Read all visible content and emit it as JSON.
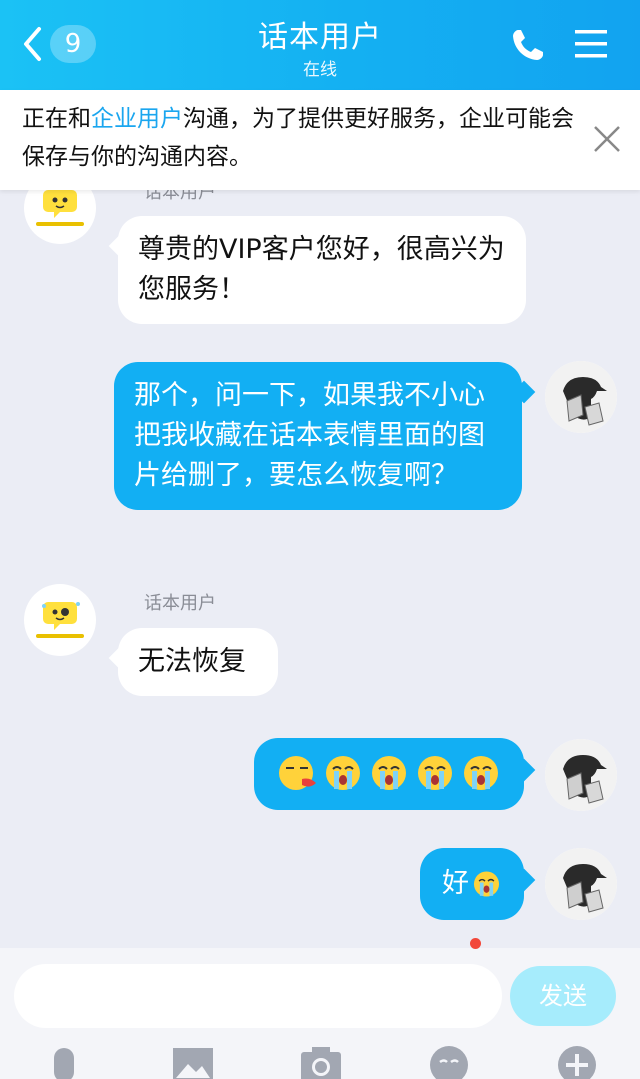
{
  "header": {
    "back_count": "9",
    "title": "话本用户",
    "status": "在线",
    "icons": [
      "chevron-left-icon",
      "phone-icon",
      "menu-icon"
    ]
  },
  "notice": {
    "text_before": "正在和",
    "highlight": "企业用户",
    "text_after": "沟通，为了提供更好服务，企业可能会保存与你的沟通内容。",
    "close_icon": "close-icon"
  },
  "chat": {
    "messages": [
      {
        "from": "them",
        "sender": "话本用户",
        "text": "尊贵的VIP客户您好，很高兴为您服务！"
      },
      {
        "from": "me",
        "text": "那个，问一下，如果我不小心把我收藏在话本表情里面的图片给删了，要怎么恢复啊？"
      },
      {
        "from": "them",
        "sender": "话本用户",
        "text": "无法恢复"
      },
      {
        "from": "me",
        "emojis": [
          "vomit-emoji",
          "crying-emoji",
          "crying-emoji",
          "crying-emoji",
          "crying-emoji"
        ]
      },
      {
        "from": "me",
        "text": "好",
        "trailing_emoji": "crying-emoji"
      }
    ]
  },
  "input": {
    "placeholder": "",
    "value": "",
    "send_label": "发送"
  },
  "toolbar": {
    "items": [
      "microphone-icon",
      "image-icon",
      "camera-icon",
      "emoji-icon",
      "plus-icon"
    ],
    "emoji_has_dot": true
  },
  "colors": {
    "header": "#15b3f2",
    "accent": "#1aa6ef",
    "bubble_out": "#12aff3",
    "send_disabled": "#a6ecfc",
    "background": "#ebedf5"
  }
}
